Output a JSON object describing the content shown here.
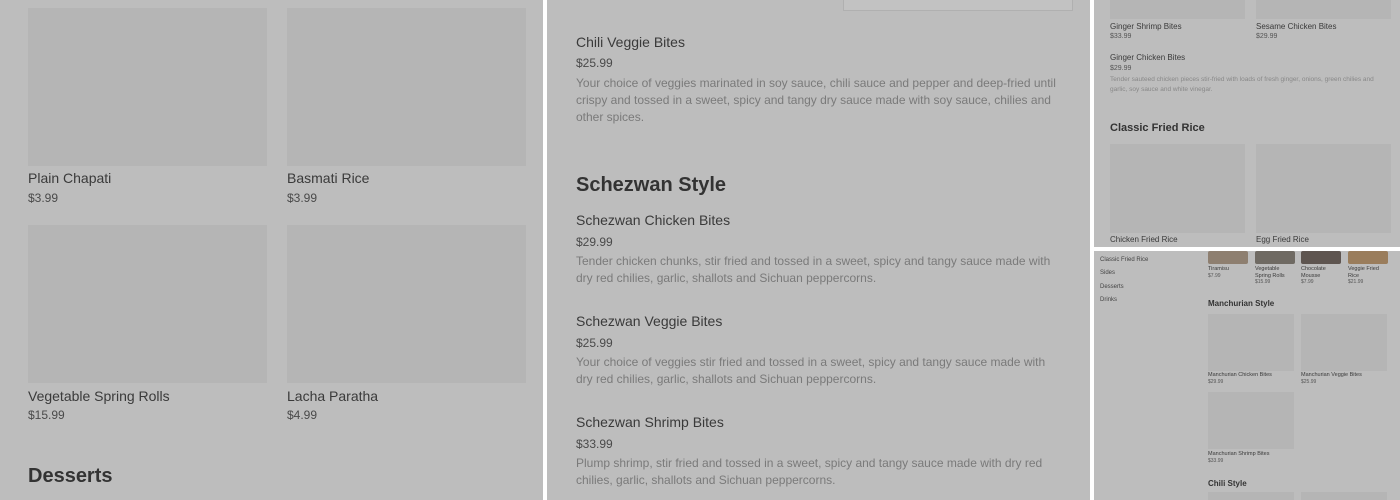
{
  "panel1": {
    "items": [
      {
        "name": "Plain Chapati",
        "price": "$3.99"
      },
      {
        "name": "Basmati Rice",
        "price": "$3.99"
      },
      {
        "name": "Vegetable Spring Rolls",
        "price": "$15.99"
      },
      {
        "name": "Lacha Paratha",
        "price": "$4.99"
      }
    ],
    "section_heading": "Desserts"
  },
  "panel2": {
    "chili_veggie": {
      "name": "Chili Veggie Bites",
      "price": "$25.99",
      "description": "Your choice of veggies marinated in soy sauce, chili sauce and pepper and deep-fried until crispy and tossed in a sweet, spicy and tangy dry sauce made with soy sauce, chilies and other spices."
    },
    "section_heading": "Schezwan Style",
    "items": [
      {
        "name": "Schezwan Chicken Bites",
        "price": "$29.99",
        "description": "Tender chicken chunks, stir fried and tossed in a sweet, spicy and tangy sauce made with dry red chilies, garlic, shallots and Sichuan peppercorns."
      },
      {
        "name": "Schezwan Veggie Bites",
        "price": "$25.99",
        "description": "Your choice of veggies stir fried and tossed in a sweet, spicy and tangy sauce made with dry red chilies, garlic, shallots and Sichuan peppercorns."
      },
      {
        "name": "Schezwan Shrimp Bites",
        "price": "$33.99",
        "description": "Plump shrimp, stir fried and tossed in a sweet, spicy and tangy sauce made with dry red chilies, garlic, shallots and Sichuan peppercorns."
      }
    ]
  },
  "panel3": {
    "top_items": [
      {
        "name": "Ginger Shrimp Bites",
        "price": "$33.99"
      },
      {
        "name": "Sesame Chicken Bites",
        "price": "$29.99"
      }
    ],
    "ginger_chicken": {
      "name": "Ginger Chicken Bites",
      "price": "$29.99",
      "description": "Tender sauteed chicken pieces stir-fried with loads of fresh ginger, onions, green chilies and garlic, soy sauce and white vinegar."
    },
    "section_heading": "Classic Fried Rice",
    "rice_items": [
      {
        "name": "Chicken Fried Rice"
      },
      {
        "name": "Egg Fried Rice"
      }
    ]
  },
  "panel4": {
    "sidebar": [
      "Classic Fried Rice",
      "Sides",
      "Desserts",
      "Drinks"
    ],
    "top_row": [
      {
        "name": "Tiramisu",
        "price": "$7.99"
      },
      {
        "name": "Vegetable Spring Rolls",
        "price": "$15.99"
      },
      {
        "name": "Chocolate Mousse",
        "price": "$7.99"
      },
      {
        "name": "Veggie Fried Rice",
        "price": "$21.99"
      }
    ],
    "manchurian_heading": "Manchurian Style",
    "manchurian_items": [
      {
        "name": "Manchurian Chicken Bites",
        "price": "$29.99"
      },
      {
        "name": "Manchurian Veggie Bites",
        "price": "$25.99"
      },
      {
        "name": "Manchurian Shrimp Bites",
        "price": "$33.99"
      }
    ],
    "chili_heading": "Chili Style"
  },
  "colors": {
    "panel_bg": "#bdbdbd",
    "placeholder": "#b5b5b5",
    "divider": "#ffffff"
  }
}
